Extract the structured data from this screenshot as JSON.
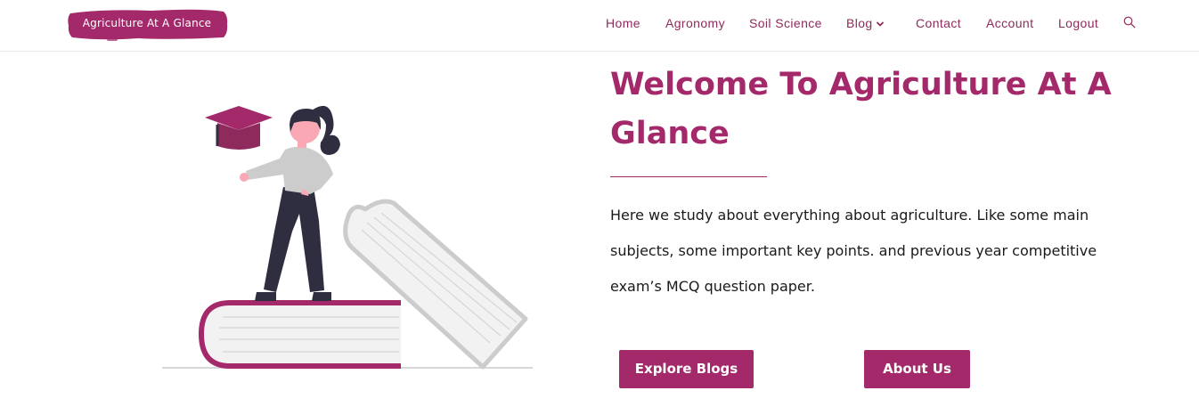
{
  "header": {
    "logo_text": "Agriculture At A Glance",
    "nav": [
      {
        "label": "Home"
      },
      {
        "label": "Agronomy"
      },
      {
        "label": "Soil Science"
      },
      {
        "label": "Blog"
      },
      {
        "label": "Contact"
      },
      {
        "label": "Account"
      },
      {
        "label": "Logout"
      }
    ],
    "blog_dropdown_icon": "chevron-down-icon",
    "search_icon": "search-icon"
  },
  "hero": {
    "title": "Welcome To Agriculture At A Glance",
    "description": "Here we study about everything about agriculture. Like some main subjects, some important key points. and previous year competitive exam’s MCQ question paper.",
    "buttons": {
      "explore": "Explore Blogs",
      "about": "About Us"
    }
  },
  "colors": {
    "accent": "#a3296a",
    "nav_text": "#8e2a5c",
    "body_text": "#1a1a1a",
    "illustration_dark": "#2f2e41",
    "illustration_gray": "#cccccc"
  }
}
